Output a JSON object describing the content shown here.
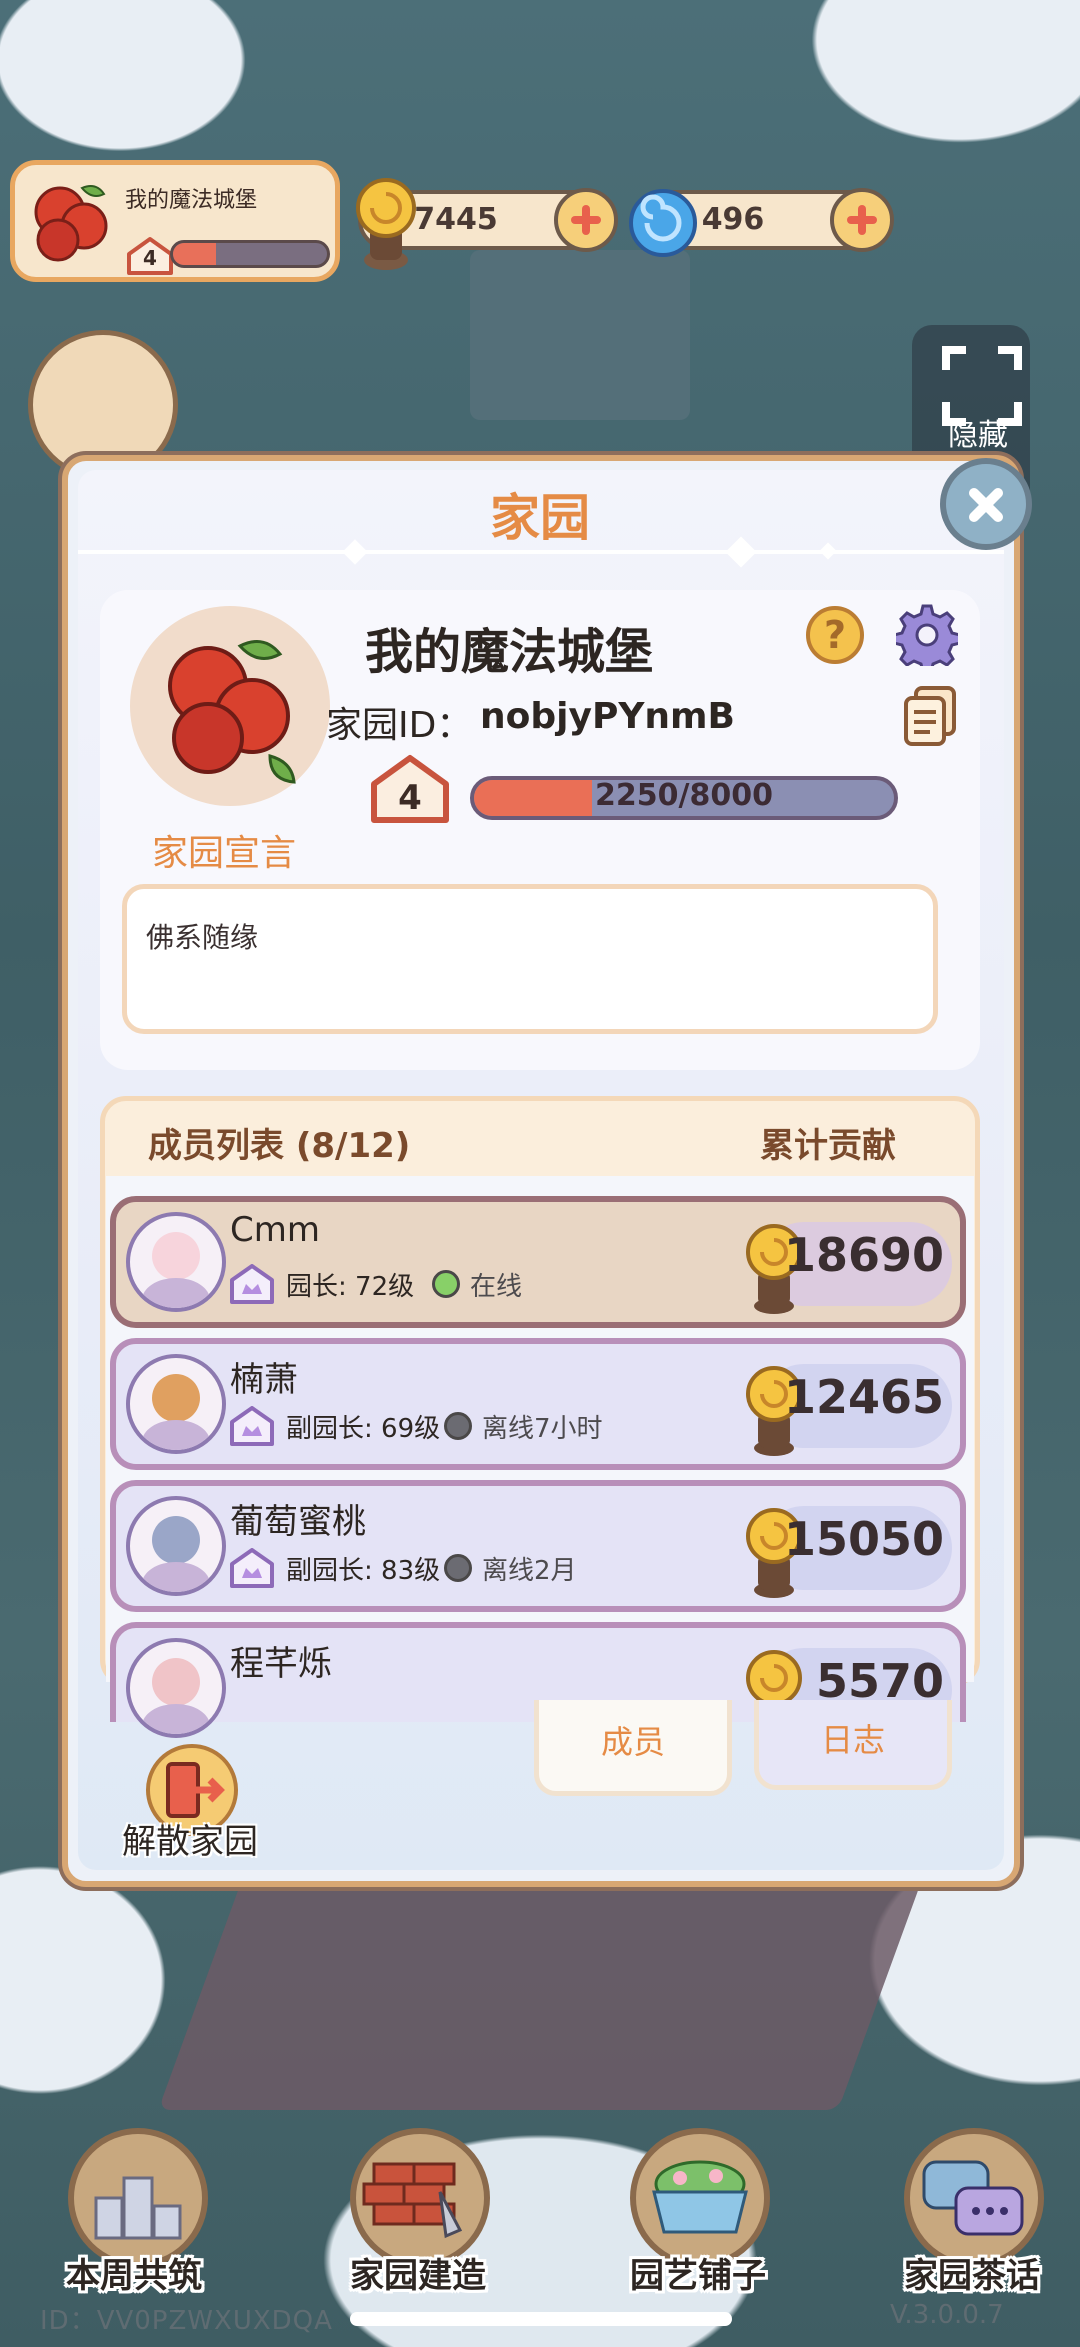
{
  "hud": {
    "home_name": "我的魔法城堡",
    "home_level": "4",
    "home_level_progress": 0.28,
    "coins": "7445",
    "gems": "496",
    "hide_label": "隐藏"
  },
  "panel": {
    "title": "家园",
    "home_name": "我的魔法城堡",
    "id_label": "家园ID：",
    "id_value": "nobjyPYnmB",
    "level": "4",
    "exp_text": "2250/8000",
    "exp_progress": 0.281,
    "declaration_label": "家园宣言",
    "declaration_text": "佛系随缘"
  },
  "members": {
    "header": "成员列表 (8/12)",
    "contribution_header": "累计贡献",
    "rows": [
      {
        "name": "Cmm",
        "role": "园长: 72级",
        "status": "在线",
        "online": true,
        "contribution": "18690"
      },
      {
        "name": "楠萧",
        "role": "副园长: 69级",
        "status": "离线7小时",
        "online": false,
        "contribution": "12465"
      },
      {
        "name": "葡萄蜜桃",
        "role": "副园长: 83级",
        "status": "离线2月",
        "online": false,
        "contribution": "15050"
      },
      {
        "name": "程芊烁",
        "role": "",
        "status": "",
        "online": false,
        "contribution": "5570"
      }
    ]
  },
  "tabs": {
    "members": "成员",
    "log": "日志"
  },
  "disband_label": "解散家园",
  "nav": {
    "weekly": "本周共筑",
    "build": "家园建造",
    "shop": "园艺铺子",
    "chat": "家园茶话"
  },
  "footer": {
    "id": "ID：VV0PZWXUXDQA",
    "version": "V.3.0.0.7"
  },
  "colors": {
    "accent_orange": "#e58b45",
    "exp_fill": "#ea6f56",
    "online": "#88d068",
    "offline": "#6b6b72",
    "panel_border": "#d8a773"
  }
}
